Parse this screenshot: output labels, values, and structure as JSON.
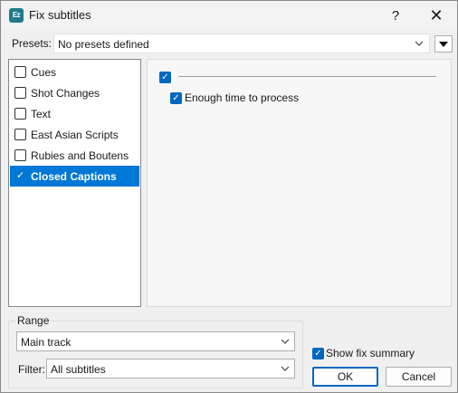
{
  "window": {
    "title": "Fix subtitles",
    "app_icon_text": "Ez",
    "help_label": "?",
    "close_label": "✕"
  },
  "presets": {
    "label": "Presets:",
    "value": "No presets defined"
  },
  "categories": [
    {
      "label": "Cues",
      "checked": false,
      "selected": false
    },
    {
      "label": "Shot Changes",
      "checked": false,
      "selected": false
    },
    {
      "label": "Text",
      "checked": false,
      "selected": false
    },
    {
      "label": "East Asian Scripts",
      "checked": false,
      "selected": false
    },
    {
      "label": "Rubies and Boutens",
      "checked": false,
      "selected": false
    },
    {
      "label": "Closed Captions",
      "checked": true,
      "selected": true
    }
  ],
  "panel": {
    "group_checked": true,
    "options": [
      {
        "label": "Enough time to process",
        "checked": true
      }
    ]
  },
  "range": {
    "legend": "Range",
    "track_value": "Main track",
    "filter_label": "Filter:",
    "filter_value": "All subtitles"
  },
  "footer": {
    "show_summary_label": "Show fix summary",
    "show_summary_checked": true,
    "ok_label": "OK",
    "cancel_label": "Cancel"
  },
  "colors": {
    "accent": "#0078d7",
    "checkbox": "#0067c0",
    "window_bg": "#f0f0f0"
  }
}
